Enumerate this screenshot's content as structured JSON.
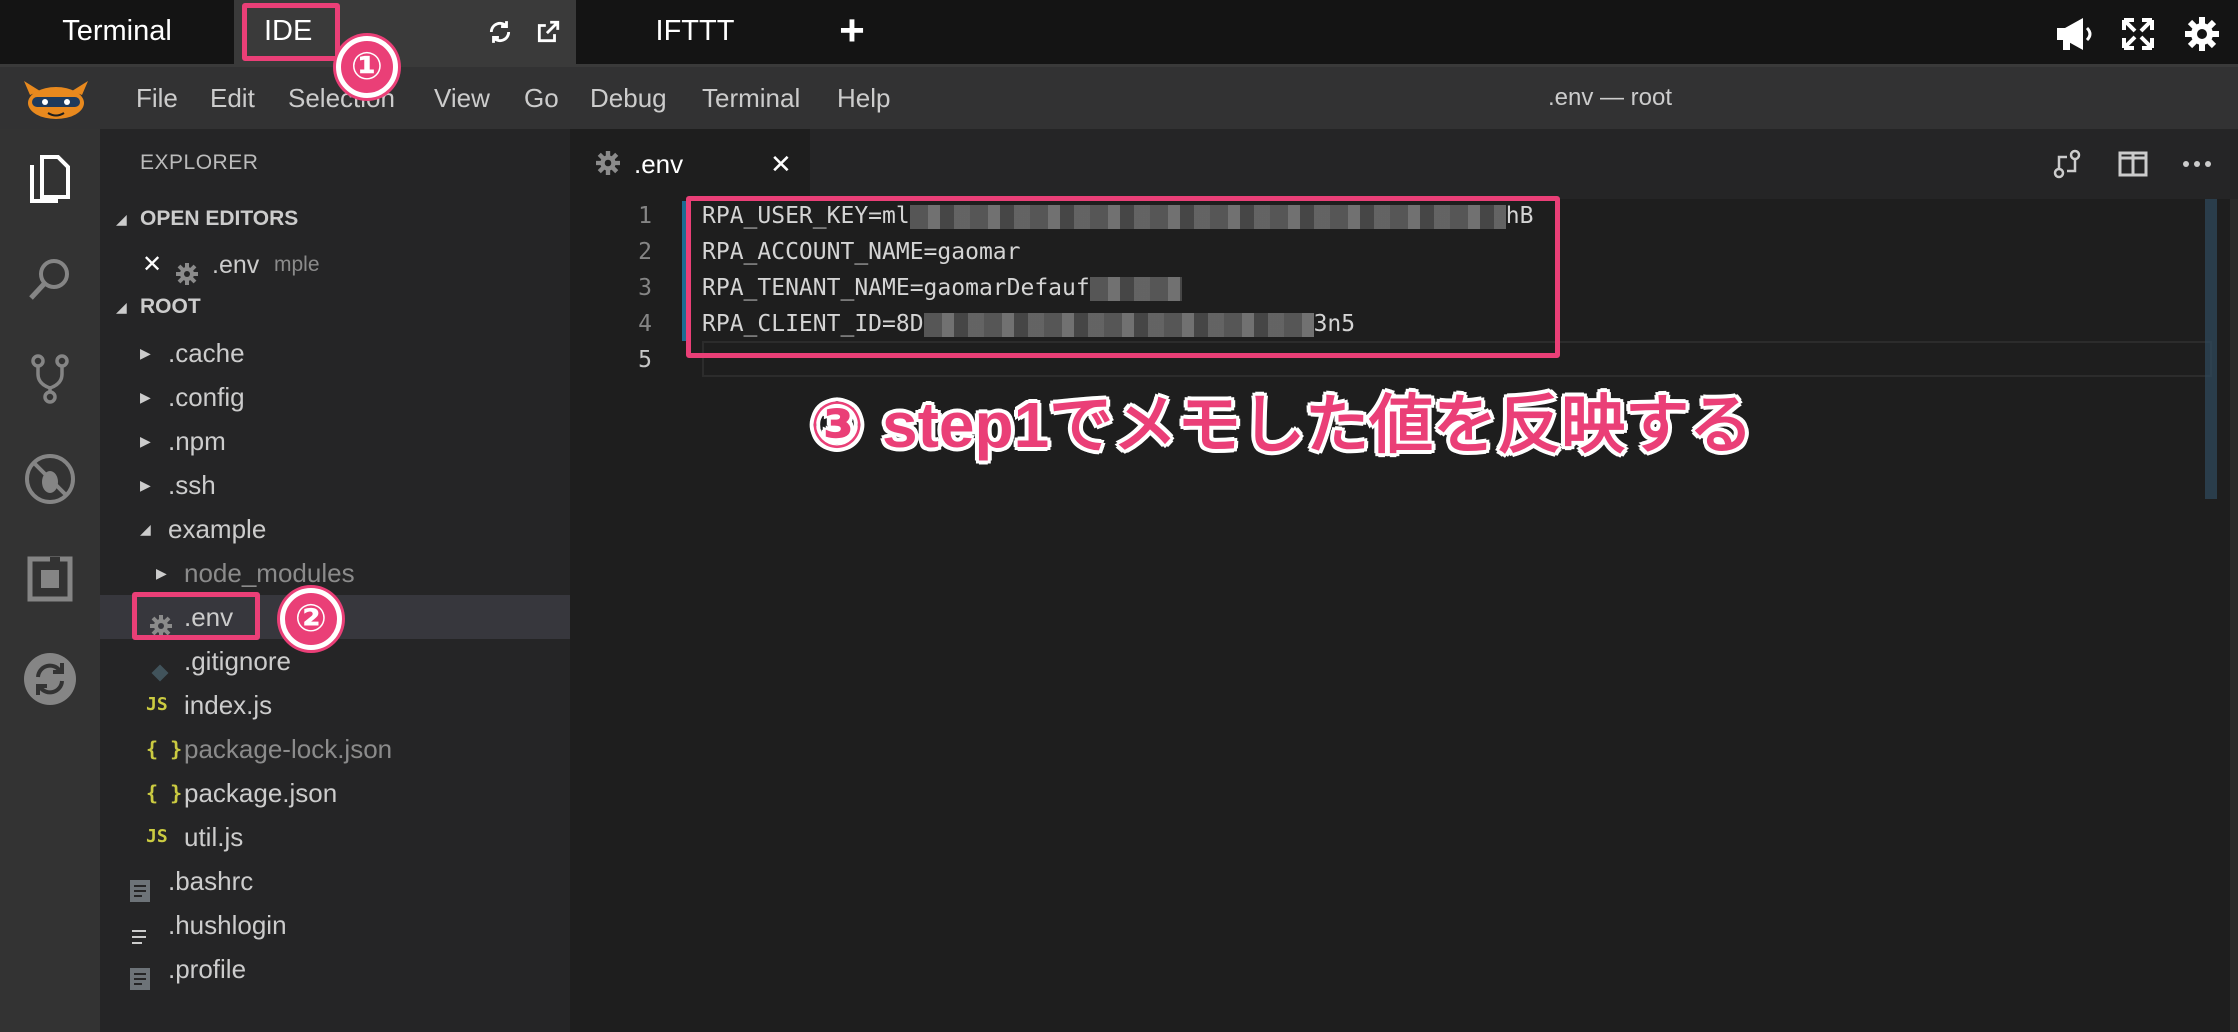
{
  "host": {
    "tabs": [
      {
        "label": "Terminal"
      },
      {
        "label": "IDE"
      },
      {
        "label": "IFTTT"
      }
    ],
    "new_tab": "+",
    "icons": [
      "refresh-icon",
      "external-link-icon",
      "megaphone-icon",
      "fullscreen-icon",
      "settings-gear-icon"
    ]
  },
  "menubar": {
    "items": [
      "File",
      "Edit",
      "Selection",
      "View",
      "Go",
      "Debug",
      "Terminal",
      "Help"
    ],
    "title": ".env — root"
  },
  "activitybar": {
    "icons": [
      "explorer-icon",
      "search-icon",
      "source-control-icon",
      "debug-icon",
      "extensions-icon",
      "sync-icon"
    ]
  },
  "sidebar": {
    "title": "EXPLORER",
    "open_editors_label": "OPEN EDITORS",
    "open_editor": {
      "close": "✕",
      "name": ".env",
      "folder": "mple"
    },
    "root_label": "ROOT",
    "tree": [
      {
        "name": ".cache",
        "kind": "folder"
      },
      {
        "name": ".config",
        "kind": "folder"
      },
      {
        "name": ".npm",
        "kind": "folder"
      },
      {
        "name": ".ssh",
        "kind": "folder"
      },
      {
        "name": "example",
        "kind": "folder-open"
      },
      {
        "name": "node_modules",
        "kind": "folder"
      },
      {
        "name": ".env",
        "kind": "settings-file"
      },
      {
        "name": ".gitignore",
        "kind": "git-file"
      },
      {
        "name": "index.js",
        "kind": "js-file",
        "badge": "JS"
      },
      {
        "name": "package-lock.json",
        "kind": "json-file",
        "badge": "{ }"
      },
      {
        "name": "package.json",
        "kind": "json-file",
        "badge": "{ }"
      },
      {
        "name": "util.js",
        "kind": "js-file",
        "badge": "JS"
      },
      {
        "name": ".bashrc",
        "kind": "text-file"
      },
      {
        "name": ".hushlogin",
        "kind": "lines-file"
      },
      {
        "name": ".profile",
        "kind": "text-file"
      }
    ]
  },
  "editor": {
    "tab": {
      "name": ".env",
      "close": "✕"
    },
    "line_numbers": [
      "1",
      "2",
      "3",
      "4",
      "5"
    ],
    "lines": [
      {
        "before": "RPA_USER_KEY=ml",
        "after": "hB"
      },
      {
        "before": "RPA_ACCOUNT_NAME=gaomar",
        "after": ""
      },
      {
        "before": "RPA_TENANT_NAME=gaomarDefauf",
        "after": ""
      },
      {
        "before": "RPA_CLIENT_ID=8D",
        "after": "3n5"
      },
      {
        "before": "",
        "after": ""
      }
    ]
  },
  "annotations": {
    "badge1": "①",
    "badge2": "②",
    "callout": "③ step1でメモした値を反映する",
    "color": "#ea3f77"
  }
}
